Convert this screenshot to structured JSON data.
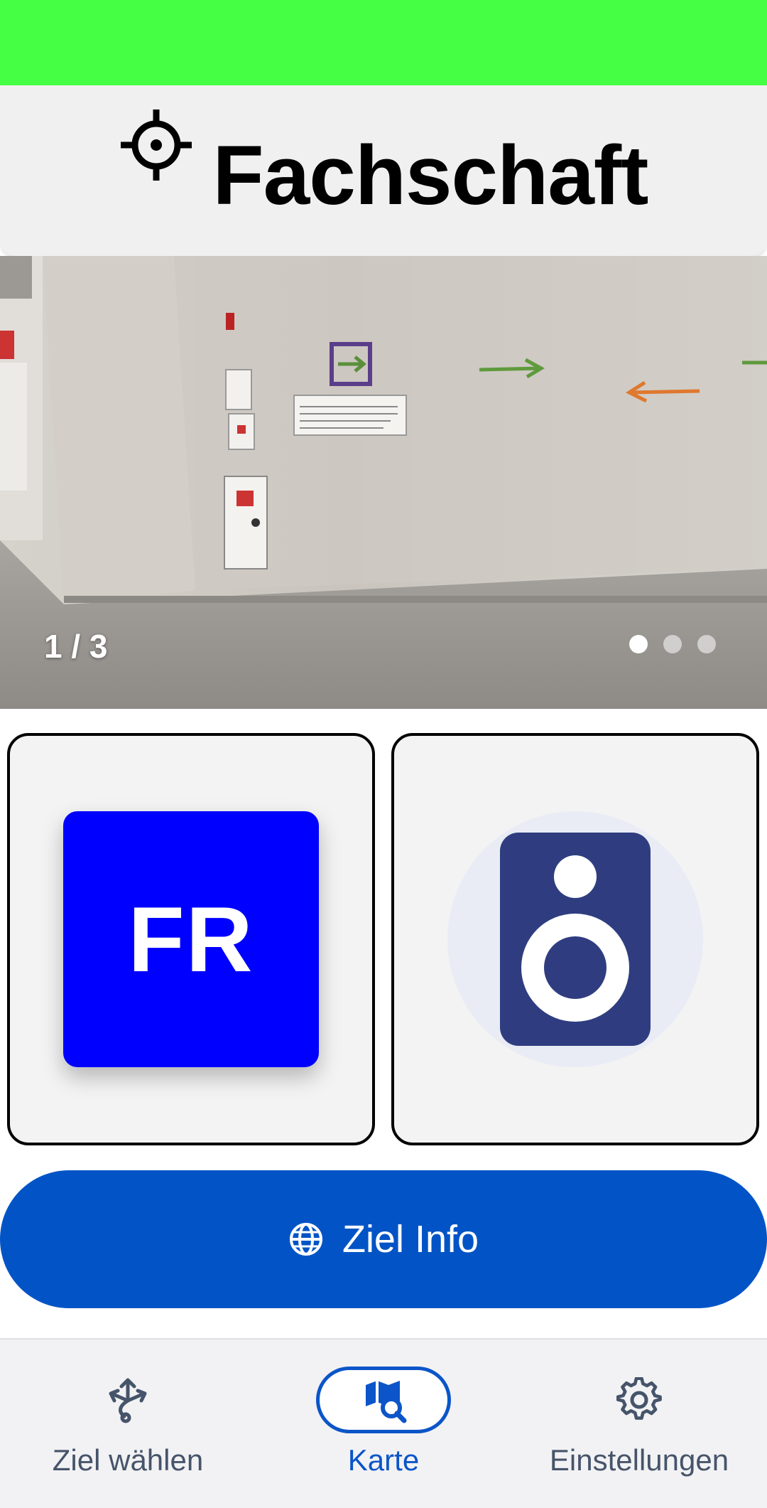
{
  "header": {
    "title": "Fachschaft",
    "icon": "crosshair-icon"
  },
  "carousel": {
    "counter": "1 / 3",
    "current": 1,
    "total": 3
  },
  "tiles": {
    "left": {
      "badge_text": "FR",
      "badge_color": "#0000ff"
    },
    "right": {
      "icon": "speaker-icon",
      "icon_color": "#2f3d80"
    }
  },
  "cta": {
    "label": "Ziel Info",
    "icon": "globe-icon",
    "color": "#0254c6"
  },
  "nav": {
    "items": [
      {
        "label": "Ziel wählen",
        "icon": "route-icon"
      },
      {
        "label": "Karte",
        "icon": "map-search-icon",
        "active": true
      },
      {
        "label": "Einstellungen",
        "icon": "gear-icon"
      }
    ],
    "accent": "#0b55c8"
  },
  "colors": {
    "status_bar": "#44ff44",
    "header_bg": "#f0f0f0"
  }
}
